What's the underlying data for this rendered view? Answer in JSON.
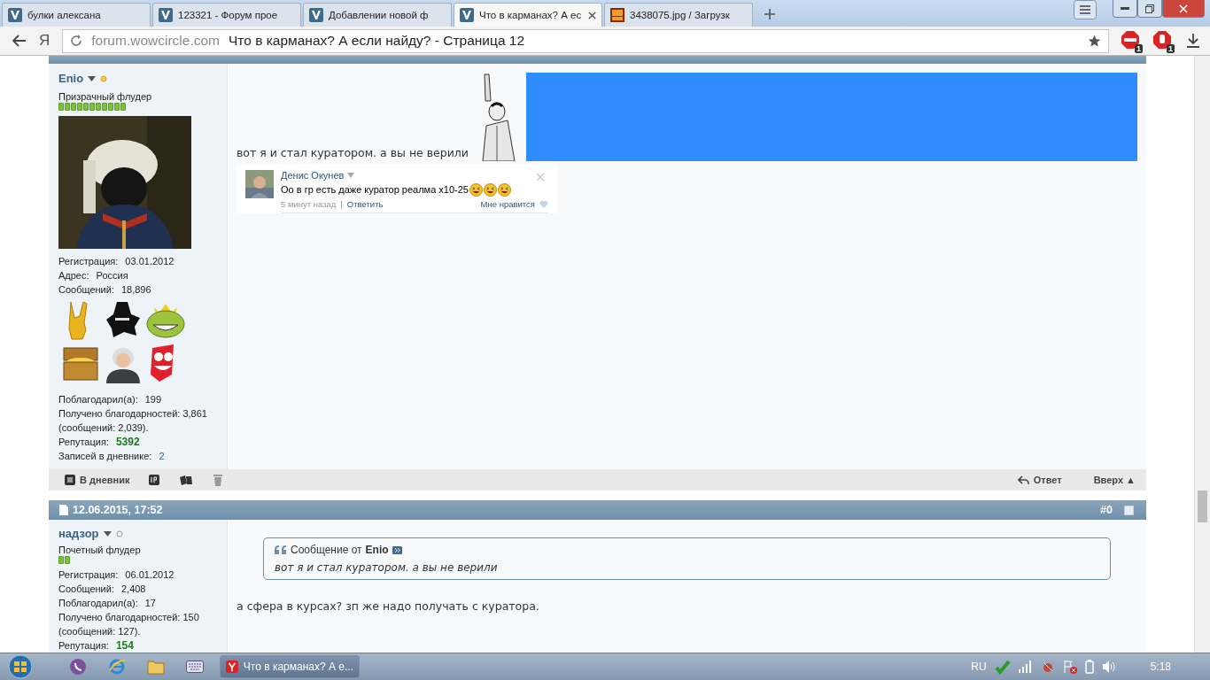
{
  "browser": {
    "tabs": [
      {
        "title": "булки алексана",
        "selected": false,
        "kind": "forum"
      },
      {
        "title": "123321 - Форум прое",
        "selected": false,
        "kind": "forum"
      },
      {
        "title": "Добавлении новой ф",
        "selected": false,
        "kind": "forum"
      },
      {
        "title": "Что в карманах? А ес",
        "selected": true,
        "kind": "forum"
      },
      {
        "title": "3438075.jpg / Загрузк",
        "selected": false,
        "kind": "upload"
      }
    ],
    "address": {
      "host": "forum.wowcircle.com",
      "title": "Что в карманах? А если найду? - Страница 12"
    },
    "home": "Я",
    "badges": [
      "1",
      "1"
    ]
  },
  "posts": [
    {
      "user": {
        "name": "Enio",
        "online": true,
        "rank": "Призрачный флудер",
        "rank_bar": [
          {
            "filled": true
          },
          {
            "filled": true
          },
          {
            "filled": true
          },
          {
            "filled": true
          },
          {
            "filled": true
          },
          {
            "filled": true
          },
          {
            "filled": true
          },
          {
            "filled": true
          },
          {
            "filled": true
          },
          {
            "filled": true
          },
          {
            "filled": true
          }
        ],
        "avatar": {
          "kind": "picture"
        },
        "stats": [
          {
            "label": "Регистрация:",
            "value": "03.01.2012",
            "kind": "plain"
          },
          {
            "label": "Адрес:",
            "value": "Россия",
            "kind": "plain"
          },
          {
            "label": "Сообщений:",
            "value": "18,896",
            "kind": "plain"
          }
        ],
        "awards": [
          {
            "kind": "horns"
          },
          {
            "kind": "splash"
          },
          {
            "kind": "troll"
          },
          {
            "kind": "chest"
          },
          {
            "kind": "person"
          },
          {
            "kind": "grin"
          }
        ],
        "stats2": [
          {
            "label": "Поблагодарил(а):",
            "value": "199",
            "kind": "plain"
          },
          {
            "label": "Получено благодарностей:",
            "value": "3,861 (сообщений: 2,039).",
            "kind": "wrapped"
          },
          {
            "label": "Репутация:",
            "value": "5392",
            "kind": "reputation"
          },
          {
            "label": "Записей в дневнике:",
            "value": "2",
            "kind": "link"
          }
        ]
      },
      "message": "вот я и стал куратором. а вы не верили",
      "media": [
        {
          "kind": "picture"
        },
        {
          "kind": "placeholder"
        }
      ],
      "comment": {
        "author": "Денис Окунев",
        "text": "Оо в гр есть даже куратор реалма x10-25",
        "time": "5 минут назад",
        "separator": "|",
        "reply": "Ответить",
        "like": "Мне нравится"
      },
      "footer": {
        "diary": "В дневник",
        "reply": "Ответ",
        "top": "Вверх ▲"
      }
    },
    {
      "header": {
        "date": "12.06.2015, 17:52",
        "number": "#0",
        "selected": false
      },
      "user": {
        "name": "надзор",
        "online": false,
        "rank": "Почетный флудер",
        "rank_bar": [
          {
            "filled": true
          },
          {
            "filled": true
          }
        ],
        "stats": [
          {
            "label": "Регистрация:",
            "value": "06.01.2012",
            "kind": "plain"
          },
          {
            "label": "Сообщений:",
            "value": "2,408",
            "kind": "plain"
          },
          {
            "label": "Поблагодарил(а):",
            "value": "17",
            "kind": "plain"
          },
          {
            "label": "Получено благодарностей:",
            "value": "150 (сообщений: 127).",
            "kind": "wrapped"
          },
          {
            "label": "Репутация:",
            "value": "154",
            "kind": "reputation"
          }
        ]
      },
      "quote": {
        "prefix": "Сообщение от",
        "author": "Enio",
        "text": "вот я и стал куратором. а вы не верили"
      },
      "message": "а сфера в курсах? зп же надо получать с куратора."
    }
  ],
  "taskbar": {
    "window": "Что в карманах? А е...",
    "language": "RU",
    "time": "5:18"
  }
}
